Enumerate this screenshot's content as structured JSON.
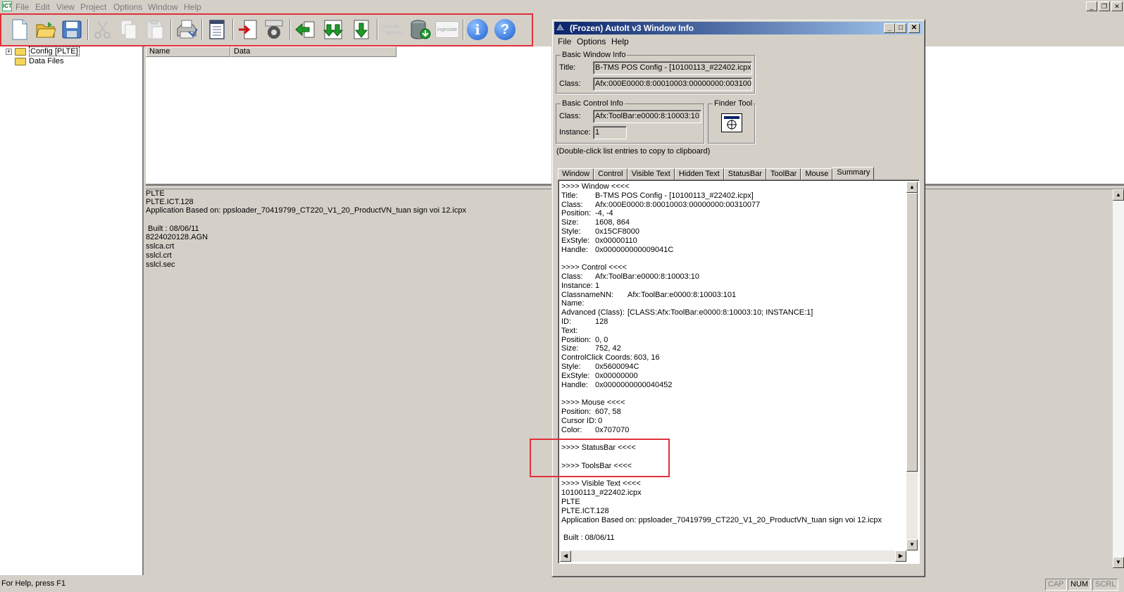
{
  "app": {
    "icon_text": "ICT",
    "menu": [
      "File",
      "Edit",
      "View",
      "Project",
      "Options",
      "Window",
      "Help"
    ],
    "mdi_buttons": [
      "_",
      "❐",
      "✕"
    ]
  },
  "toolbar": {
    "buttons": [
      {
        "name": "new",
        "icon": "new-document-icon"
      },
      {
        "name": "open",
        "icon": "open-folder-icon"
      },
      {
        "name": "save",
        "icon": "floppy-disk-icon"
      },
      {
        "name": "cut",
        "icon": "scissors-icon"
      },
      {
        "name": "copy",
        "icon": "copy-icon"
      },
      {
        "name": "paste",
        "icon": "paste-icon"
      },
      {
        "name": "print",
        "icon": "printer-icon"
      },
      {
        "name": "properties",
        "icon": "properties-sheet-icon"
      },
      {
        "name": "import",
        "icon": "import-arrow-icon"
      },
      {
        "name": "compile",
        "icon": "compile-gear-icon"
      },
      {
        "name": "back",
        "icon": "green-left-arrow-icon"
      },
      {
        "name": "download-all",
        "icon": "double-down-arrow-icon"
      },
      {
        "name": "download",
        "icon": "down-arrow-icon"
      },
      {
        "name": "transfer",
        "icon": "transfer-arrows-icon"
      },
      {
        "name": "database",
        "icon": "database-icon"
      },
      {
        "name": "ingestate",
        "icon": "ingestate-logo-icon",
        "text": "ingestate"
      },
      {
        "name": "info",
        "icon": "info-icon",
        "text": "i"
      },
      {
        "name": "help",
        "icon": "help-question-icon",
        "text": "?"
      }
    ]
  },
  "tree": {
    "items": [
      {
        "label": "Config [PLTE]",
        "expander": "+"
      },
      {
        "label": "Data Files"
      }
    ]
  },
  "list": {
    "columns": [
      "Name",
      "Data"
    ]
  },
  "detail": {
    "lines": [
      "PLTE",
      "PLTE.ICT.128",
      "Application Based on: ppsloader_70419799_CT220_V1_20_ProductVN_tuan sign voi 12.icpx",
      "",
      " Built : 08/06/11",
      "8224020128.AGN",
      "sslca.crt",
      "sslcl.crt",
      "sslcl.sec"
    ]
  },
  "status": {
    "text": "For Help, press F1",
    "indicators": [
      "CAP",
      "NUM",
      "SCRL"
    ]
  },
  "autoit": {
    "title": "(Frozen) AutoIt v3 Window Info",
    "caption_buttons": [
      "_",
      "□",
      "✕"
    ],
    "menu": [
      "File",
      "Options",
      "Help"
    ],
    "basic_window": {
      "group": "Basic Window Info",
      "title_label": "Title:",
      "title_value": "B-TMS POS Config - [10100113_#22402.icpx]",
      "class_label": "Class:",
      "class_value": "Afx:000E0000:8:00010003:00000000:00310077"
    },
    "basic_control": {
      "group": "Basic Control Info",
      "class_label": "Class:",
      "class_value": "Afx:ToolBar:e0000:8:10003:10",
      "instance_label": "Instance:",
      "instance_value": "1"
    },
    "finder": {
      "group": "Finder Tool"
    },
    "hint": "(Double-click list entries to copy to clipboard)",
    "tabs": [
      "Window",
      "Control",
      "Visible Text",
      "Hidden Text",
      "StatusBar",
      "ToolBar",
      "Mouse",
      "Summary"
    ],
    "active_tab": "Summary",
    "summary": [
      {
        "k": ">>>> Window <<<<",
        "v": ""
      },
      {
        "k": "Title:",
        "v": "B-TMS POS Config - [10100113_#22402.icpx]"
      },
      {
        "k": "Class:",
        "v": "Afx:000E0000:8:00010003:00000000:00310077"
      },
      {
        "k": "Position:",
        "v": "-4, -4"
      },
      {
        "k": "Size:",
        "v": "1608, 864"
      },
      {
        "k": "Style:",
        "v": "0x15CF8000"
      },
      {
        "k": "ExStyle:",
        "v": "0x00000110"
      },
      {
        "k": "Handle:",
        "v": "0x000000000009041C"
      },
      {
        "k": "",
        "v": ""
      },
      {
        "k": ">>>> Control <<<<",
        "v": ""
      },
      {
        "k": "Class:",
        "v": "Afx:ToolBar:e0000:8:10003:10"
      },
      {
        "k": "Instance:",
        "v": "1"
      },
      {
        "k": "ClassnameNN:",
        "v": "Afx:ToolBar:e0000:8:10003:101",
        "wide": true
      },
      {
        "k": "Name:",
        "v": ""
      },
      {
        "k": "Advanced (Class):",
        "v": "[CLASS:Afx:ToolBar:e0000:8:10003:10; INSTANCE:1]",
        "wide": true
      },
      {
        "k": "ID:",
        "v": "128"
      },
      {
        "k": "Text:",
        "v": ""
      },
      {
        "k": "Position:",
        "v": "0, 0"
      },
      {
        "k": "Size:",
        "v": "752, 42"
      },
      {
        "k": "ControlClick Coords:",
        "v": "603, 16",
        "inline": true
      },
      {
        "k": "Style:",
        "v": "0x5600094C"
      },
      {
        "k": "ExStyle:",
        "v": "0x00000000"
      },
      {
        "k": "Handle:",
        "v": "0x0000000000040452"
      },
      {
        "k": "",
        "v": ""
      },
      {
        "k": ">>>> Mouse <<<<",
        "v": ""
      },
      {
        "k": "Position:",
        "v": "607, 58"
      },
      {
        "k": "Cursor ID:",
        "v": "0",
        "inline": true
      },
      {
        "k": "Color:",
        "v": "0x707070"
      },
      {
        "k": "",
        "v": ""
      },
      {
        "k": ">>>> StatusBar <<<<",
        "v": ""
      },
      {
        "k": "",
        "v": ""
      },
      {
        "k": ">>>> ToolsBar <<<<",
        "v": ""
      },
      {
        "k": "",
        "v": ""
      },
      {
        "k": ">>>> Visible Text <<<<",
        "v": ""
      },
      {
        "k": "10100113_#22402.icpx",
        "v": ""
      },
      {
        "k": "PLTE",
        "v": ""
      },
      {
        "k": "PLTE.ICT.128",
        "v": ""
      },
      {
        "k": "Application Based on: ppsloader_70419799_CT220_V1_20_ProductVN_tuan sign voi 12.icpx",
        "v": ""
      },
      {
        "k": "",
        "v": ""
      },
      {
        "k": " Built : 08/06/11",
        "v": ""
      }
    ]
  },
  "colors": {
    "highlight": "#e0303a",
    "title_gradient_start": "#0a246a",
    "title_gradient_end": "#a6caf0",
    "face": "#d4d0c8"
  }
}
